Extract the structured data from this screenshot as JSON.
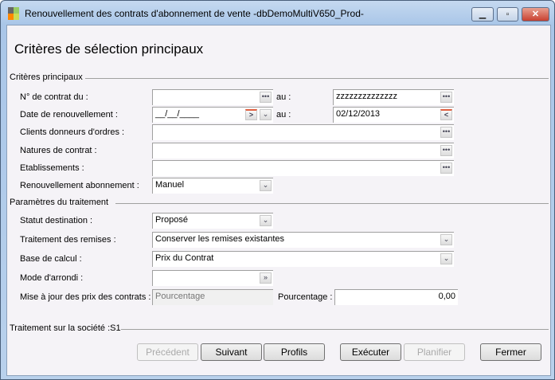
{
  "window": {
    "title": "Renouvellement des contrats d'abonnement de vente -dbDemoMultiV650_Prod-",
    "minimize": "minimize-icon",
    "maximize": "maximize-icon",
    "close": "close-icon"
  },
  "page_title": "Critères de sélection principaux",
  "section1": {
    "label": "Critères principaux",
    "contract_from_label": "N° de contrat du :",
    "contract_from_value": "",
    "contract_to_label": "au :",
    "contract_to_value": "zzzzzzzzzzzzzz",
    "date_from_label": "Date de renouvellement :",
    "date_from_value": "__/__/____",
    "date_to_label": "au :",
    "date_to_value": "02/12/2013",
    "clients_label": "Clients donneurs d'ordres :",
    "clients_value": "",
    "natures_label": "Natures de contrat :",
    "natures_value": "",
    "etab_label": "Etablissements :",
    "etab_value": "",
    "renew_label": "Renouvellement abonnement :",
    "renew_value": "Manuel"
  },
  "section2": {
    "label": "Paramètres du traitement",
    "statut_label": "Statut destination :",
    "statut_value": "Proposé",
    "remises_label": "Traitement des remises :",
    "remises_value": "Conserver les remises existantes",
    "base_label": "Base de calcul :",
    "base_value": "Prix du Contrat",
    "arrondi_label": "Mode d'arrondi :",
    "arrondi_value": "",
    "maj_label": "Mise à jour des prix des contrats :",
    "maj_value": "Pourcentage",
    "pct_label": "Pourcentage :",
    "pct_value": "0,00"
  },
  "footer": {
    "label": "Traitement sur la société :S1"
  },
  "buttons": {
    "prev": "Précédent",
    "next": "Suivant",
    "profiles": "Profils",
    "execute": "Exécuter",
    "schedule": "Planifier",
    "close": "Fermer"
  }
}
